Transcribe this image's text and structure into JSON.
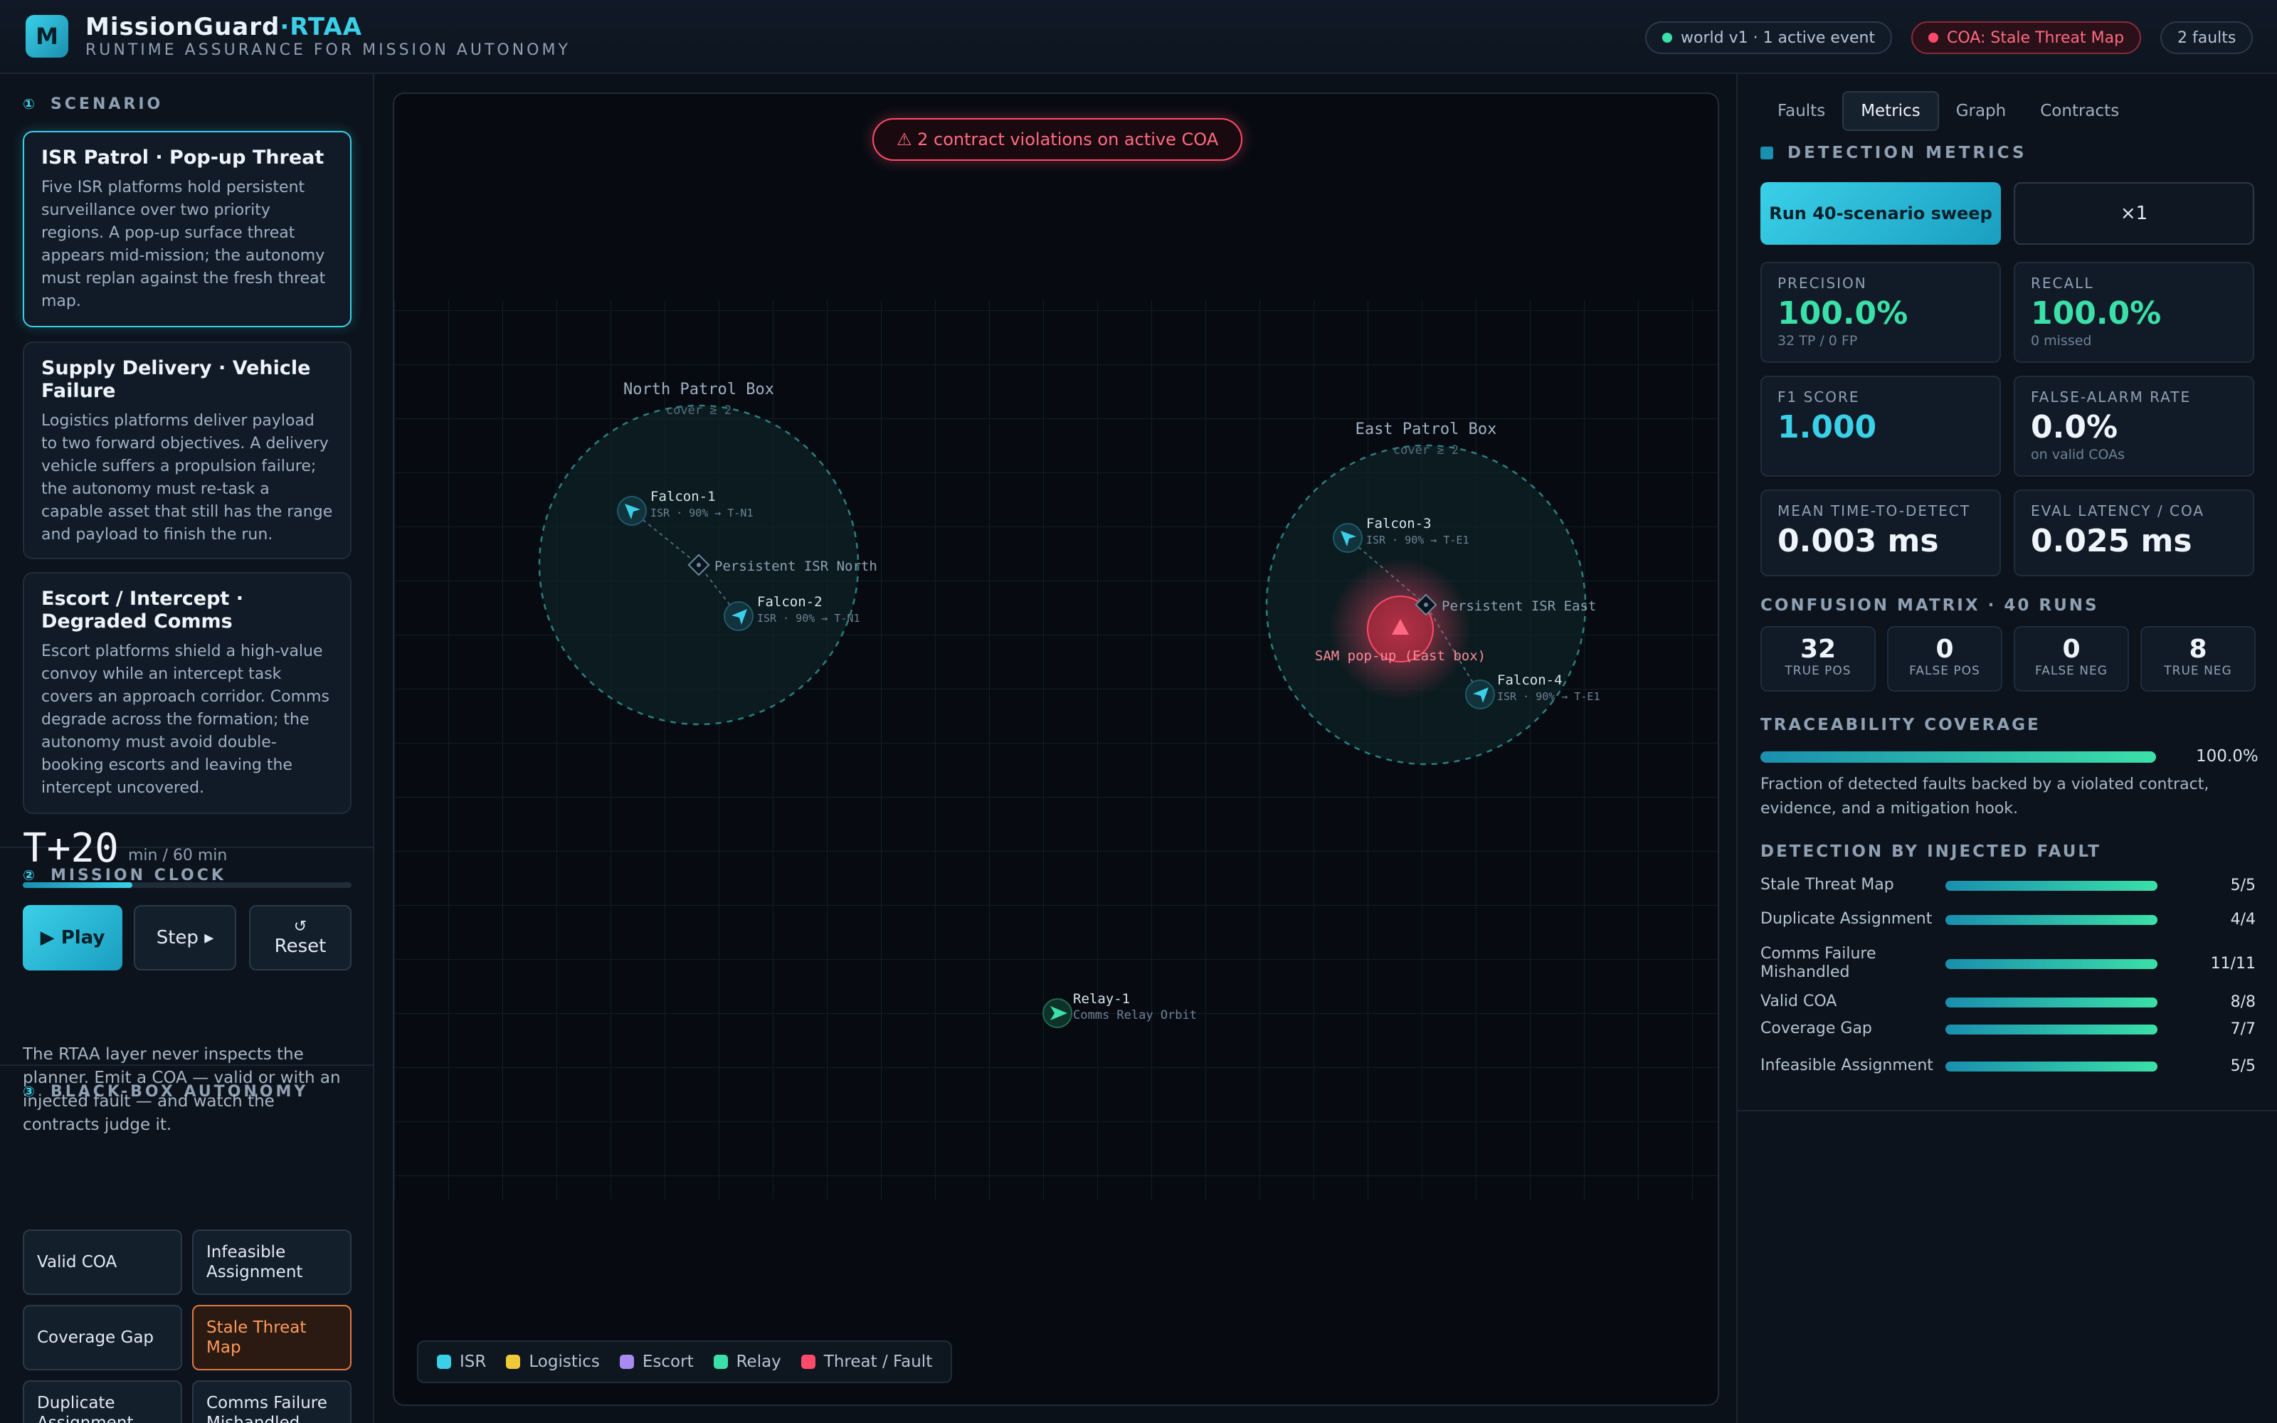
{
  "header": {
    "logo_letter": "M",
    "brand_main": "MissionGuard",
    "brand_accent": "·RTAA",
    "subtitle": "RUNTIME ASSURANCE FOR MISSION AUTONOMY",
    "world_status": "world v1 · 1 active event",
    "coa_status": "COA: Stale Threat Map",
    "faults_count": "2 faults"
  },
  "scenario": {
    "section_num": "①",
    "section_title": "SCENARIO",
    "cards": [
      {
        "title": "ISR Patrol · Pop-up Threat",
        "desc": "Five ISR platforms hold persistent surveillance over two priority regions. A pop-up surface threat appears mid-mission; the autonomy must replan against the fresh threat map."
      },
      {
        "title": "Supply Delivery · Vehicle Failure",
        "desc": "Logistics platforms deliver payload to two forward objectives. A delivery vehicle suffers a propulsion failure; the autonomy must re-task a capable asset that still has the range and payload to finish the run."
      },
      {
        "title": "Escort / Intercept · Degraded Comms",
        "desc": "Escort platforms shield a high-value convoy while an intercept task covers an approach corridor. Comms degrade across the formation; the autonomy must avoid double-booking escorts and leaving the intercept uncovered."
      }
    ]
  },
  "clock": {
    "section_num": "②",
    "section_title": "MISSION CLOCK",
    "time": "T+20",
    "unit": "min / 60 min",
    "progress": 0.333,
    "play": "▶ Play",
    "step": "Step ▸",
    "reset_icon": "↺",
    "reset": "Reset"
  },
  "blackbox": {
    "section_num": "③",
    "section_title": "BLACK-BOX AUTONOMY",
    "text": "The RTAA layer never inspects the planner. Emit a COA — valid or with an injected fault — and watch the contracts judge it.",
    "buttons": [
      "Valid COA",
      "Infeasible Assignment",
      "Coverage Gap",
      "Stale Threat Map",
      "Duplicate Assignment",
      "Comms Failure Mishandled"
    ],
    "selected": "Stale Threat Map"
  },
  "map": {
    "violation_banner": "⚠ 2 contract violations on active COA",
    "regions": [
      {
        "name": "North Patrol Box",
        "sub": "cover ≥ 2",
        "objective": "Persistent ISR North"
      },
      {
        "name": "East Patrol Box",
        "sub": "cover ≥ 2",
        "objective": "Persistent ISR East"
      }
    ],
    "assets": [
      {
        "name": "Falcon-1",
        "detail": "ISR · 90% → T-N1"
      },
      {
        "name": "Falcon-2",
        "detail": "ISR · 90% → T-N1"
      },
      {
        "name": "Falcon-3",
        "detail": "ISR · 90% → T-E1"
      },
      {
        "name": "Falcon-4",
        "detail": "ISR · 90% → T-E1"
      },
      {
        "name": "Relay-1",
        "detail": "Comms Relay Orbit"
      }
    ],
    "threat_label": "SAM pop-up (East box)",
    "legend": [
      "ISR",
      "Logistics",
      "Escort",
      "Relay",
      "Threat / Fault"
    ],
    "colors": {
      "isr": "#3ad0e8",
      "logistics": "#f0c93a",
      "escort": "#a98af0",
      "relay": "#3be0a8",
      "threat": "#ff4a6a"
    }
  },
  "metrics": {
    "tabs": [
      "Faults",
      "Metrics",
      "Graph",
      "Contracts"
    ],
    "active_tab": "Metrics",
    "section_title": "DETECTION METRICS",
    "sweep_button": "Run 40-scenario sweep",
    "speed_button": "×1",
    "cards": [
      {
        "label": "PRECISION",
        "value": "100.0%",
        "sub": "32 TP / 0 FP"
      },
      {
        "label": "RECALL",
        "value": "100.0%",
        "sub": "0 missed"
      },
      {
        "label": "F1 SCORE",
        "value": "1.000",
        "sub": ""
      },
      {
        "label": "FALSE-ALARM RATE",
        "value": "0.0%",
        "sub": "on valid COAs"
      },
      {
        "label": "MEAN TIME-TO-DETECT",
        "value": "0.003 ms",
        "sub": ""
      },
      {
        "label": "EVAL LATENCY / COA",
        "value": "0.025 ms",
        "sub": ""
      }
    ],
    "confusion_title": "CONFUSION MATRIX · 40 RUNS",
    "confusion": [
      {
        "value": "32",
        "label": "TRUE POS"
      },
      {
        "value": "0",
        "label": "FALSE POS"
      },
      {
        "value": "0",
        "label": "FALSE NEG"
      },
      {
        "value": "8",
        "label": "TRUE NEG"
      }
    ],
    "trace_title": "TRACEABILITY COVERAGE",
    "trace_value": "100.0%",
    "trace_fraction": 1.0,
    "trace_desc": "Fraction of detected faults backed by a violated contract, evidence, and a mitigation hook.",
    "byfault_title": "DETECTION BY INJECTED FAULT",
    "byfault": [
      {
        "name": "Stale Threat Map",
        "value": "5/5"
      },
      {
        "name": "Duplicate Assignment",
        "value": "4/4"
      },
      {
        "name": "Comms Failure Mishandled",
        "value": "11/11"
      },
      {
        "name": "Valid COA",
        "value": "8/8"
      },
      {
        "name": "Coverage Gap",
        "value": "7/7"
      },
      {
        "name": "Infeasible Assignment",
        "value": "5/5"
      }
    ]
  }
}
